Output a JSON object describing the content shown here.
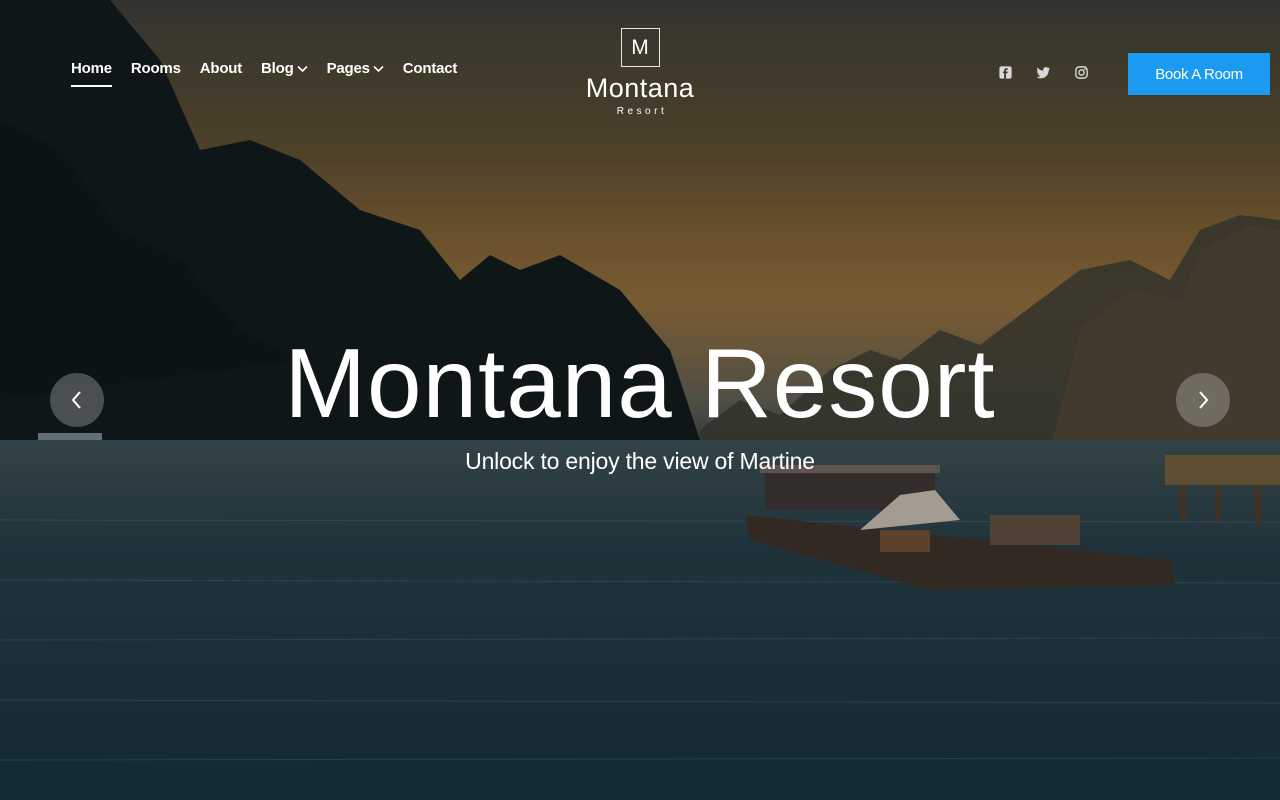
{
  "nav": {
    "items": [
      {
        "label": "Home",
        "active": true,
        "dropdown": false
      },
      {
        "label": "Rooms",
        "active": false,
        "dropdown": false
      },
      {
        "label": "About",
        "active": false,
        "dropdown": false
      },
      {
        "label": "Blog",
        "active": false,
        "dropdown": true
      },
      {
        "label": "Pages",
        "active": false,
        "dropdown": true
      },
      {
        "label": "Contact",
        "active": false,
        "dropdown": false
      }
    ]
  },
  "logo": {
    "letter": "M",
    "name": "Montana",
    "subtitle": "Resort"
  },
  "social": {
    "icons": [
      "facebook-icon",
      "twitter-icon",
      "instagram-icon"
    ]
  },
  "header": {
    "book_label": "Book A Room"
  },
  "hero": {
    "title": "Montana Resort",
    "subtitle": "Unlock to enjoy the view of Martine"
  },
  "colors": {
    "accent": "#1b9af2",
    "text": "#ffffff"
  }
}
